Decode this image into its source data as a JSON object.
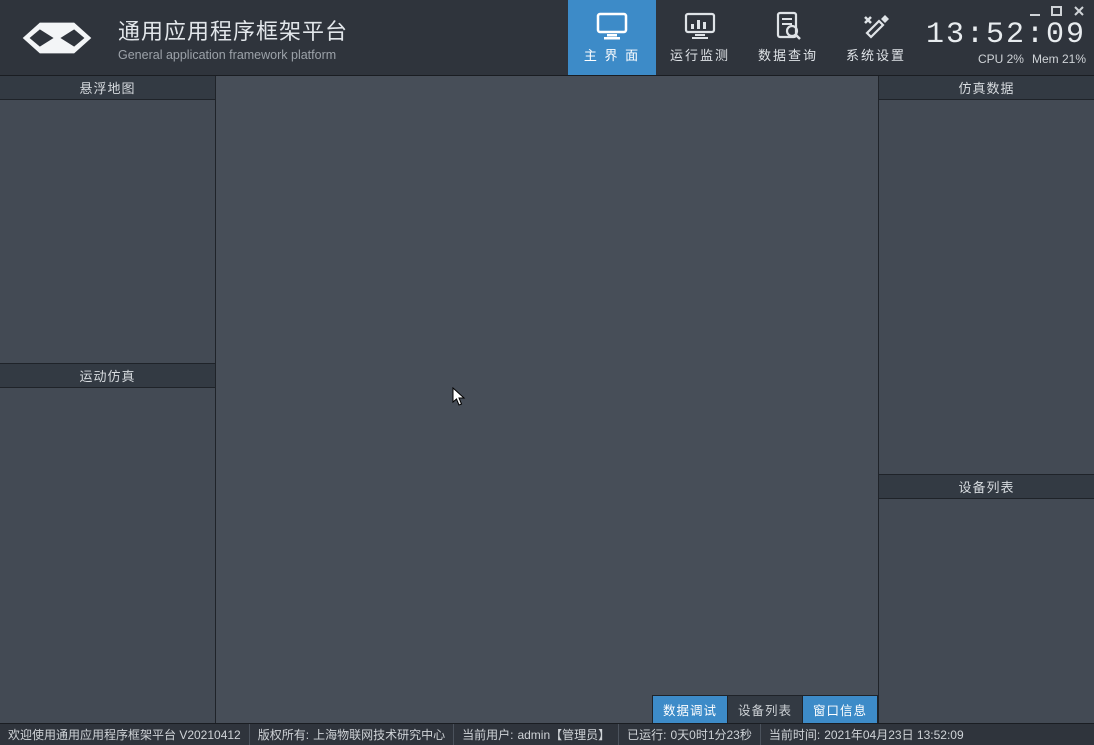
{
  "header": {
    "title_cn": "通用应用程序框架平台",
    "title_en": "General application framework platform",
    "nav": [
      {
        "label": "主 界 面",
        "icon": "monitor",
        "active": true
      },
      {
        "label": "运行监测",
        "icon": "chart",
        "active": false
      },
      {
        "label": "数据查询",
        "icon": "search-doc",
        "active": false
      },
      {
        "label": "系统设置",
        "icon": "tools",
        "active": false
      }
    ],
    "clock": "13:52:09",
    "cpu_label": "CPU 2%",
    "mem_label": "Mem 21%"
  },
  "panels": {
    "left_top": "悬浮地图",
    "left_bot": "运动仿真",
    "right_top": "仿真数据",
    "right_bot": "设备列表"
  },
  "float_tabs": [
    {
      "label": "数据调试",
      "active": true
    },
    {
      "label": "设备列表",
      "active": false
    },
    {
      "label": "窗口信息",
      "active": true
    }
  ],
  "status": {
    "welcome": "欢迎使用通用应用程序框架平台 V20210412",
    "copyright_label": "版权所有:",
    "copyright_value": "上海物联网技术研究中心",
    "user_label": "当前用户:",
    "user_value": "admin【管理员】",
    "runtime_label": "已运行:",
    "runtime_value": "0天0时1分23秒",
    "time_label": "当前时间:",
    "time_value": "2021年04月23日 13:52:09"
  }
}
